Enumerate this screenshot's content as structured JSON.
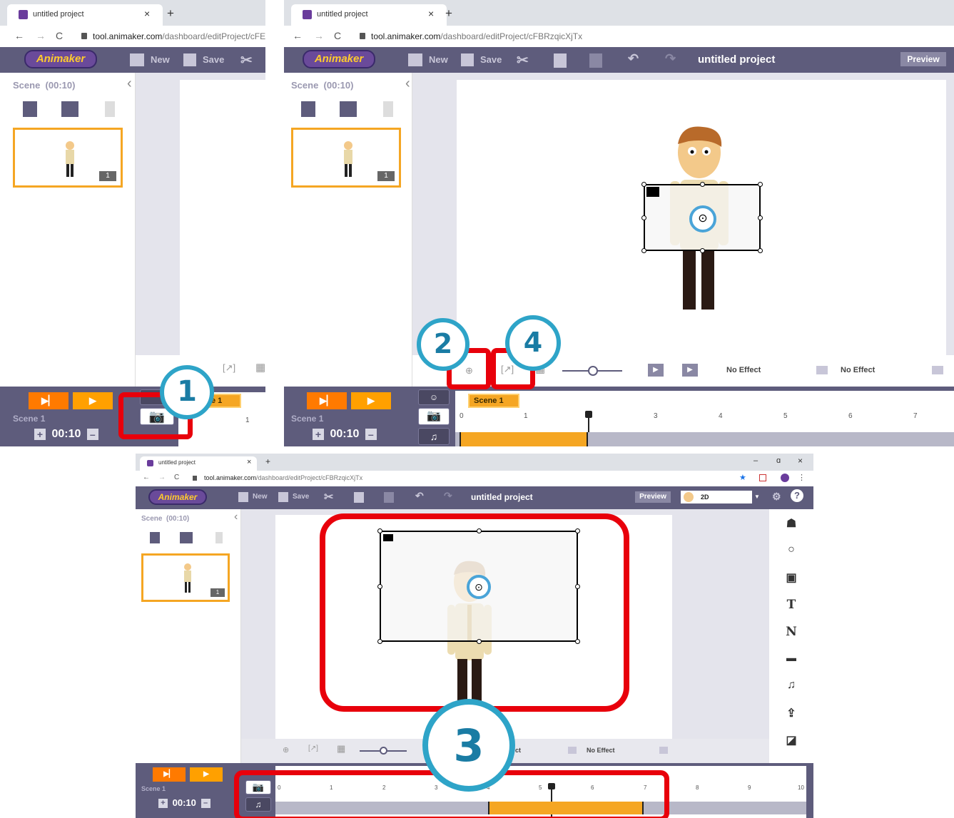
{
  "browser": {
    "tab_title": "untitled project",
    "tab_close": "×",
    "new_tab": "+",
    "url_domain": "tool.animaker.com",
    "url_path_full": "/dashboard/editProject/cFBRzqicXjTx",
    "url_path_cut": "/dashboard/editProject/cFE",
    "nav_back": "←",
    "nav_forward": "→",
    "nav_reload": "C",
    "lock": "🔒",
    "window_min": "–",
    "window_max": "ɑ",
    "window_close": "×"
  },
  "app": {
    "logo": "Animaker",
    "toolbar": {
      "new": "New",
      "save": "Save"
    },
    "project_title": "untitled project",
    "preview": "Preview",
    "mode": "2D"
  },
  "scene_panel": {
    "header": "Scene  (00:10)",
    "collapse": "‹",
    "thumb_badge": "1"
  },
  "bottom": {
    "scene_label": "Scene 1",
    "duration": "00:10",
    "plus": "+",
    "minus": "–",
    "scene_tab": "Scene 1",
    "scene_tab_cut": "e 1",
    "ruler_full": [
      "0",
      "1",
      "2",
      "3",
      "4",
      "5",
      "6",
      "7"
    ],
    "ruler_big": [
      "0",
      "1",
      "2",
      "3",
      "4",
      "5",
      "6",
      "7",
      "8",
      "9",
      "10"
    ],
    "ruler_cut": [
      "1"
    ]
  },
  "controls": {
    "effect1": "No Effect",
    "effect2": "No Effect",
    "effect_cut": "ct"
  },
  "annotations": {
    "one": "1",
    "two": "2",
    "three": "3",
    "four": "4"
  },
  "right_sidebar": [
    "character-icon",
    "bulb-icon",
    "image-icon",
    "text-icon",
    "n-icon",
    "video-icon",
    "music-icon",
    "upload-icon",
    "background-icon"
  ],
  "colors": {
    "accent_orange": "#ff7a00",
    "highlight_red": "#e8000b",
    "callout_blue": "#2ea4c8",
    "toolbar": "#5e5c7c"
  }
}
